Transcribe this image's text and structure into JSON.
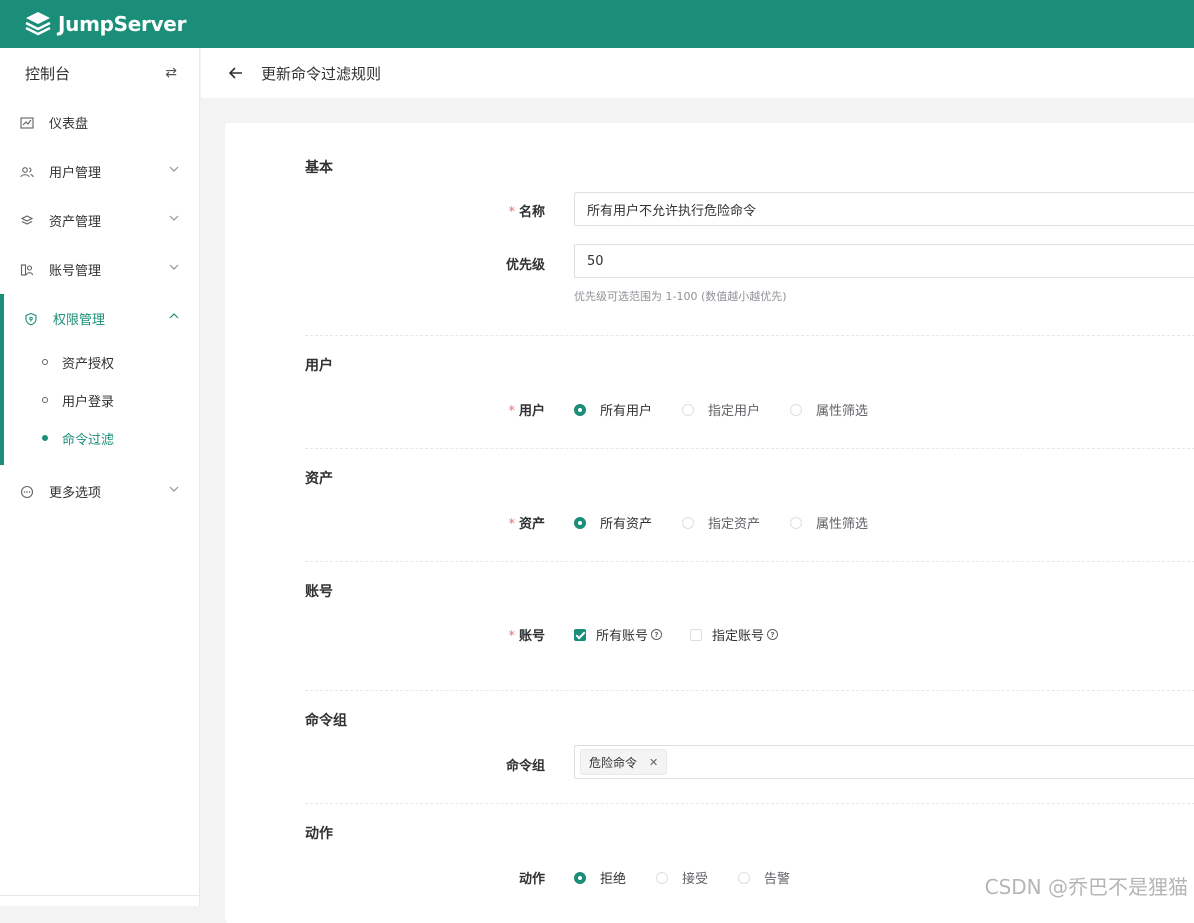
{
  "app": {
    "name": "JumpServer",
    "accent": "#1a8e78"
  },
  "sidebar": {
    "header": "控制台",
    "items": [
      {
        "label": "仪表盘",
        "icon": "chart-icon"
      },
      {
        "label": "用户管理",
        "icon": "users-icon"
      },
      {
        "label": "资产管理",
        "icon": "layers-icon"
      },
      {
        "label": "账号管理",
        "icon": "account-icon"
      }
    ],
    "active_group": {
      "label": "权限管理",
      "icon": "shield-icon",
      "subitems": [
        {
          "label": "资产授权"
        },
        {
          "label": "用户登录"
        },
        {
          "label": "命令过滤"
        }
      ]
    },
    "more": {
      "label": "更多选项",
      "icon": "more-icon"
    }
  },
  "header": {
    "title": "更新命令过滤规则"
  },
  "form": {
    "basic": {
      "title": "基本",
      "name_label": "名称",
      "name_value": "所有用户不允许执行危险命令",
      "priority_label": "优先级",
      "priority_value": "50",
      "priority_help": "优先级可选范围为 1-100 (数值越小越优先)"
    },
    "users": {
      "title": "用户",
      "label": "用户",
      "options": [
        "所有用户",
        "指定用户",
        "属性筛选"
      ],
      "selected": "所有用户"
    },
    "assets": {
      "title": "资产",
      "label": "资产",
      "options": [
        "所有资产",
        "指定资产",
        "属性筛选"
      ],
      "selected": "所有资产"
    },
    "accounts": {
      "title": "账号",
      "label": "账号",
      "options": [
        "所有账号",
        "指定账号"
      ],
      "checked": "所有账号"
    },
    "cmd_groups": {
      "title": "命令组",
      "label": "命令组",
      "tags": [
        "危险命令"
      ]
    },
    "action": {
      "title": "动作",
      "label": "动作",
      "options": [
        "拒绝",
        "接受",
        "告警"
      ],
      "selected": "拒绝"
    }
  },
  "watermark": "CSDN @乔巴不是狸猫"
}
